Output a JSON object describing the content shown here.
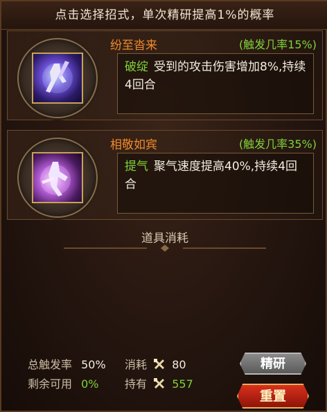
{
  "header": {
    "instruction": "点击选择招式，单次精研提高1%的概率"
  },
  "skills": [
    {
      "name": "纷至沓来",
      "trigger": "(触发几率15%)",
      "effect_key": "破绽",
      "effect_text": "受到的攻击伤害增加8%,持续4回合"
    },
    {
      "name": "相敬如宾",
      "trigger": "(触发几率35%)",
      "effect_key": "提气",
      "effect_text": "聚气速度提高40%,持续4回合"
    }
  ],
  "materials": {
    "title": "道具消耗"
  },
  "stats": {
    "total_rate_label": "总触发率",
    "total_rate_value": "50%",
    "remaining_label": "剩余可用",
    "remaining_value": "0%",
    "cost_label": "消耗",
    "cost_value": "80",
    "owned_label": "持有",
    "owned_value": "557"
  },
  "buttons": {
    "refine": "精研",
    "reset": "重置"
  },
  "icons": {
    "material": "crossed-hammer-icon"
  },
  "colors": {
    "accent_orange": "#f08a2a",
    "accent_green": "#7fd33a",
    "reset_red": "#c4200f"
  }
}
